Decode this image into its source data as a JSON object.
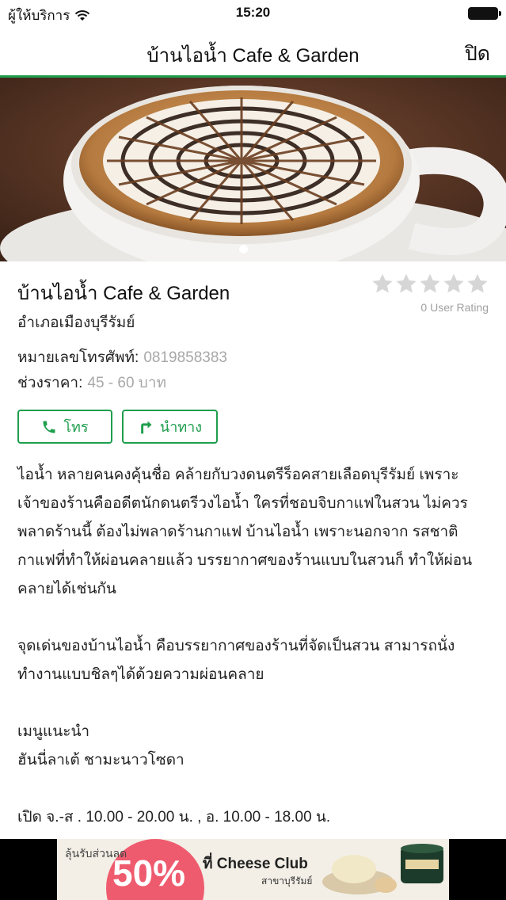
{
  "status": {
    "carrier": "ผู้ให้บริการ",
    "time": "15:20"
  },
  "nav": {
    "title": "บ้านไอน้ำ  Cafe & Garden",
    "close_label": "ปิด"
  },
  "place": {
    "name": "บ้านไอน้ำ  Cafe & Garden",
    "district": "อำเภอเมืองบุรีรัมย์",
    "rating_text": "0 User Rating",
    "rating_value": 0,
    "rating_max": 5,
    "phone_label": "หมายเลขโทรศัพท์:",
    "phone_value": "0819858383",
    "price_label": "ช่วงราคา:",
    "price_value": "45 - 60 บาท"
  },
  "actions": {
    "call_label": "โทร",
    "navigate_label": "นำทาง"
  },
  "description": {
    "p1": "ไอน้ำ  หลายคนคงคุ้นชื่อ  คล้ายกับวงดนตรีร็อคสายเลือดบุรีรัมย์ เพราะเจ้าของร้านคืออดีตนักดนตรีวงไอน้ำ  ใครที่ชอบจิบกาแฟในสวน ไม่ควรพลาดร้านนี้  ต้องไม่พลาดร้านกาแฟ บ้านไอน้ำ  เพราะนอกจาก รสชาติกาแฟที่ทำให้ผ่อนคลายแล้ว  บรรยากาศของร้านแบบในสวนก็ ทำให้ผ่อนคลายได้เช่นกัน",
    "p2": "จุดเด่นของบ้านไอน้ำ  คือบรรยากาศของร้านที่จัดเป็นสวน  สามารถนั่ง ทำงานแบบชิลๆได้ด้วยความผ่อนคลาย",
    "p3a": "เมนูแนะนำ",
    "p3b": "ฮันนี่ลาเต้  ชามะนาวโซดา",
    "p4": "เปิด จ.-ส  . 10.00 - 20.00 น. ,       อ. 10.00 - 18.00 น."
  },
  "ad": {
    "deal_label": "ลุ้นรับส่วนลด",
    "percent": "50%",
    "brand": "ที่ Cheese Club",
    "branch": "สาขาบุรีรัมย์"
  },
  "colors": {
    "accent": "#1f9e4d",
    "muted_text": "#a8a8a8",
    "ad_pink": "#ef5b6e"
  }
}
